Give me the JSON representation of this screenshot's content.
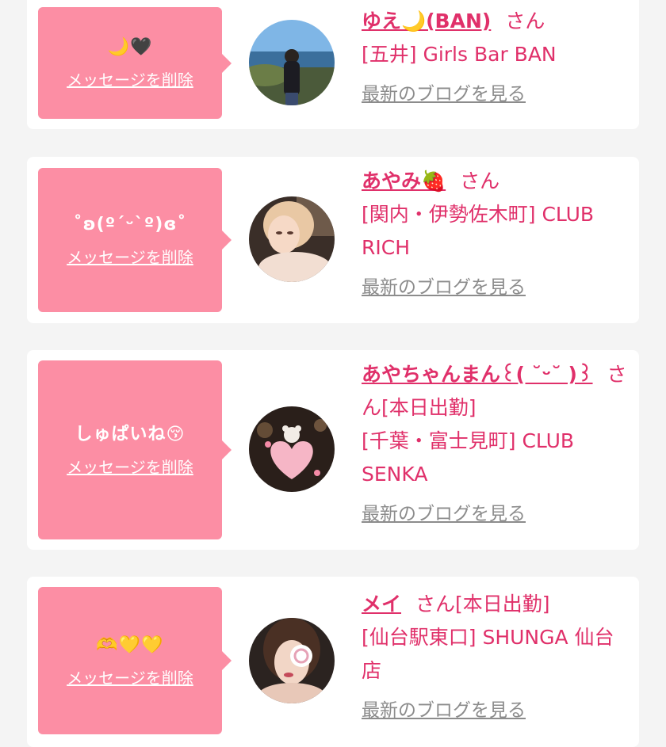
{
  "cards": [
    {
      "message": "🌙🖤",
      "delete_label": "メッセージを削除",
      "name": "ゆえ🌙(BAN)",
      "honorific": "さん",
      "status": "",
      "shop": "[五井] Girls Bar BAN",
      "blog_label": "最新のブログを見る"
    },
    {
      "message": "˚ʚ(ºˊᵕˋº)ɞ˚",
      "delete_label": "メッセージを削除",
      "name": "あやみ🍓",
      "honorific": "さん",
      "status": "",
      "shop": "[関内・伊勢佐木町] CLUB RICH",
      "blog_label": "最新のブログを見る"
    },
    {
      "message": "しゅぱいね😚",
      "delete_label": "メッセージを削除",
      "name": "あやちゃんまん꒰( ˘ᵕ˘ )꒱",
      "honorific": "さん",
      "status": "[本日出勤]",
      "shop": "[千葉・富士見町] CLUB SENKA",
      "blog_label": "最新のブログを見る"
    },
    {
      "message": "🫶💛💛",
      "delete_label": "メッセージを削除",
      "name": "メイ",
      "honorific": "さん",
      "status": "[本日出勤]",
      "shop": "[仙台駅東口] SHUNGA 仙台店",
      "blog_label": "最新のブログを見る"
    }
  ]
}
